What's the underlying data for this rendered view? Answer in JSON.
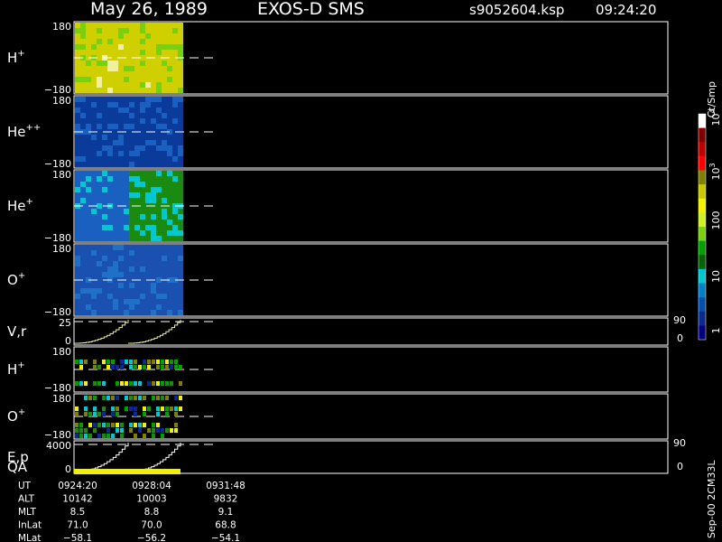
{
  "header": {
    "date": "May 26, 1989",
    "instrument": "EXOS-D SMS",
    "file": "s9052604.ksp",
    "time": "09:24:20"
  },
  "colorbar": {
    "unit": "Ct/Smp",
    "labels": [
      "1",
      "10",
      "100",
      "10",
      "10"
    ],
    "exponents": [
      "",
      "",
      "",
      "3",
      "4"
    ],
    "scale": "log",
    "range": [
      1,
      10000
    ],
    "colors": [
      "#000080",
      "#0a2a90",
      "#0050b0",
      "#0080c8",
      "#00c8d0",
      "#006400",
      "#00a000",
      "#78d010",
      "#d0f020",
      "#f0f000",
      "#c8c800",
      "#808000",
      "#ff0000",
      "#c00000",
      "#800000",
      "#ffffff"
    ]
  },
  "side_note": "Sep-00 2CM33L",
  "chart_data": [
    {
      "type": "heatmap",
      "panel": "H+",
      "label_base": "H",
      "label_sup": "+",
      "ylim": [
        -180,
        180
      ],
      "tick_labels": [
        "180",
        "−180"
      ],
      "dominant_color": "#d0d000",
      "accent_color": "#78d010"
    },
    {
      "type": "heatmap",
      "panel": "He++",
      "label_base": "He",
      "label_sup": "++",
      "ylim": [
        -180,
        180
      ],
      "tick_labels": [
        "180",
        "−180"
      ],
      "dominant_color": "#0a3a9a",
      "accent_color": "#1a60c0"
    },
    {
      "type": "heatmap",
      "panel": "He+",
      "label_base": "He",
      "label_sup": "+",
      "ylim": [
        -180,
        180
      ],
      "tick_labels": [
        "180",
        "−180"
      ],
      "dominant_color": "#1a60c0",
      "accent_color": "#00c8d0",
      "second_half_color": "#1a8a10"
    },
    {
      "type": "heatmap",
      "panel": "O+",
      "label_base": "O",
      "label_sup": "+",
      "ylim": [
        -180,
        180
      ],
      "tick_labels": [
        "180",
        "−180"
      ],
      "dominant_color": "#1a50b0",
      "accent_color": "#2070c8"
    },
    {
      "type": "line",
      "panel": "V,r",
      "label_base": "V,r",
      "ylim": [
        0,
        25
      ],
      "tick_labels": [
        "25",
        "0"
      ],
      "right_tick_labels": [
        "90",
        "0"
      ]
    },
    {
      "type": "heatmap",
      "panel": "H+ (compressed)",
      "label_base": "H",
      "label_sup": "+",
      "ylim": [
        -180,
        180
      ],
      "tick_labels": [
        "180",
        "−180"
      ]
    },
    {
      "type": "heatmap",
      "panel": "O+ (compressed)",
      "label_base": "O",
      "label_sup": "+",
      "ylim": [
        -180,
        180
      ],
      "tick_labels": [
        "180",
        "−180"
      ]
    },
    {
      "type": "line",
      "panel": "E,p",
      "label_base": "E,p",
      "ylim": [
        0,
        4000
      ],
      "tick_labels": [
        "4000",
        "0"
      ],
      "right_tick_labels": [
        "90",
        "0"
      ]
    }
  ],
  "qa_label": "QA",
  "ephemeris": {
    "rows": [
      {
        "label": "UT",
        "values": [
          "0924:20",
          "0928:04",
          "0931:48"
        ]
      },
      {
        "label": "ALT",
        "values": [
          "10142",
          "10003",
          "9832"
        ]
      },
      {
        "label": "MLT",
        "values": [
          "8.5",
          "8.8",
          "9.1"
        ]
      },
      {
        "label": "InLat",
        "values": [
          "71.0",
          "70.0",
          "68.8"
        ]
      },
      {
        "label": "MLat",
        "values": [
          "−58.1",
          "−56.2",
          "−54.1"
        ]
      }
    ]
  }
}
